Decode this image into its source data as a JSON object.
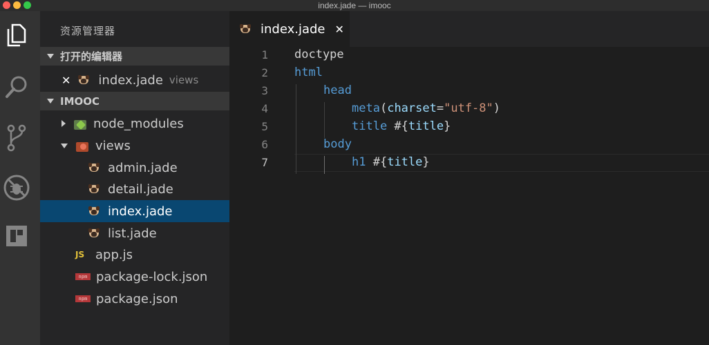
{
  "window": {
    "title": "index.jade — imooc"
  },
  "activity_bar": {
    "items": [
      {
        "icon": "files-icon"
      },
      {
        "icon": "search-icon"
      },
      {
        "icon": "source-control-icon"
      },
      {
        "icon": "debug-icon"
      },
      {
        "icon": "extensions-icon"
      }
    ]
  },
  "sidebar": {
    "title": "资源管理器",
    "open_editors": {
      "header": "打开的编辑器",
      "items": [
        {
          "close": "✕",
          "name": "index.jade",
          "folder": "views"
        }
      ]
    },
    "project": {
      "header": "IMOOC",
      "tree": [
        {
          "name": "node_modules",
          "type": "folder",
          "icon": "node-folder-icon",
          "expanded": false
        },
        {
          "name": "views",
          "type": "folder",
          "icon": "views-folder-icon",
          "expanded": true
        },
        {
          "name": "admin.jade",
          "type": "file",
          "icon": "pug-icon"
        },
        {
          "name": "detail.jade",
          "type": "file",
          "icon": "pug-icon"
        },
        {
          "name": "index.jade",
          "type": "file",
          "icon": "pug-icon",
          "selected": true
        },
        {
          "name": "list.jade",
          "type": "file",
          "icon": "pug-icon"
        },
        {
          "name": "app.js",
          "type": "file",
          "icon": "js-icon",
          "badge": "JS"
        },
        {
          "name": "package-lock.json",
          "type": "file",
          "icon": "npm-icon",
          "badge": "npm"
        },
        {
          "name": "package.json",
          "type": "file",
          "icon": "npm-icon",
          "badge": "npm"
        }
      ]
    }
  },
  "tabs": [
    {
      "label": "index.jade",
      "close": "✕",
      "active": true
    }
  ],
  "editor": {
    "line_numbers": [
      "1",
      "2",
      "3",
      "4",
      "5",
      "6",
      "7"
    ],
    "active_line": "7",
    "lines": [
      {
        "tokens": [
          "doctype"
        ]
      },
      {
        "tokens": [
          "html"
        ]
      },
      {
        "tokens": [
          "head"
        ]
      },
      {
        "tokens": [
          "meta",
          "(",
          "charset",
          "=",
          "\"utf-8\"",
          ")"
        ]
      },
      {
        "tokens": [
          "title",
          " #{",
          "title",
          "}"
        ]
      },
      {
        "tokens": [
          "body"
        ]
      },
      {
        "tokens": [
          "h1",
          " #{",
          "title",
          "}"
        ]
      }
    ]
  },
  "colors": {
    "tag": "#569cd6",
    "attribute": "#9cdcfe",
    "string": "#ce9178",
    "text": "#d4d4d4",
    "selection": "#094771"
  }
}
